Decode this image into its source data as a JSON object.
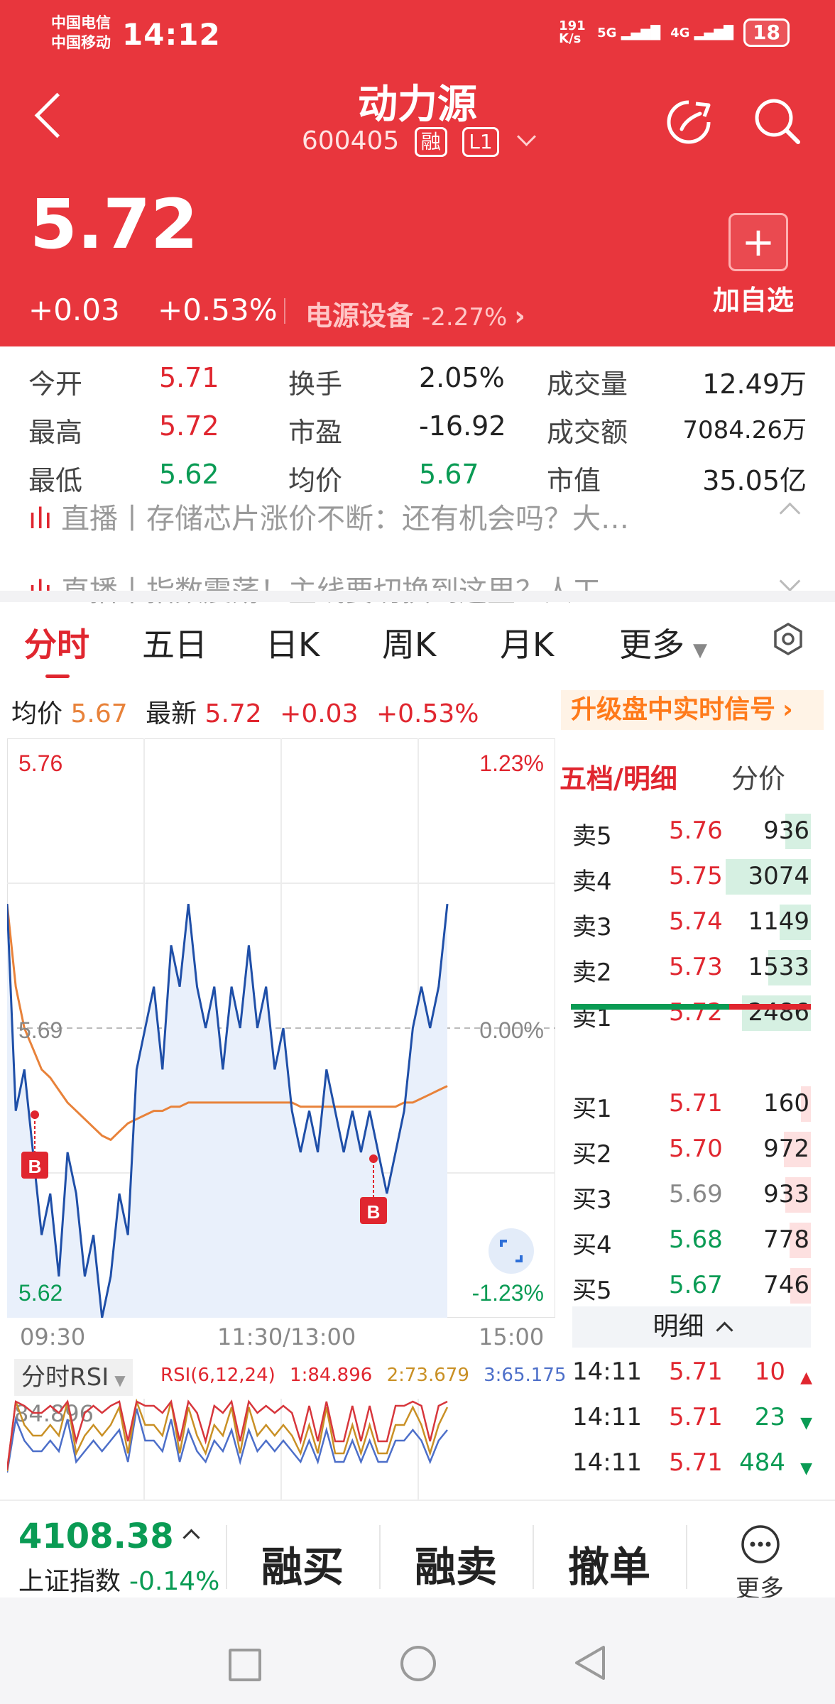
{
  "status_bar": {
    "carrier1": "中国电信",
    "carrier2": "中国移动",
    "time": "14:12",
    "net_speed": "191 K/s",
    "sig1": "5G",
    "sig2": "4G",
    "battery": "18"
  },
  "header": {
    "title": "动力源",
    "code": "600405",
    "tag_rong": "融",
    "tag_level": "L1",
    "price": "5.72",
    "change": "+0.03",
    "change_pct": "+0.53%",
    "sector": "电源设备",
    "sector_pct": "-2.27%",
    "add_label": "加自选"
  },
  "stats": [
    {
      "label": "今开",
      "value": "5.71",
      "color": "red"
    },
    {
      "label": "换手",
      "value": "2.05%",
      "color": "dark"
    },
    {
      "label": "成交量",
      "value": "12.49万",
      "color": "dark"
    },
    {
      "label": "最高",
      "value": "5.72",
      "color": "red"
    },
    {
      "label": "市盈",
      "value": "-16.92",
      "color": "dark"
    },
    {
      "label": "成交额",
      "value": "7084.26万",
      "color": "dark"
    },
    {
      "label": "最低",
      "value": "5.62",
      "color": "green"
    },
    {
      "label": "均价",
      "value": "5.67",
      "color": "green"
    },
    {
      "label": "市值",
      "value": "35.05亿",
      "color": "dark"
    }
  ],
  "news": [
    "直播丨存储芯片涨价不断：还有机会吗？大…",
    "直播丨指数震荡！主线要切换到这里？人工…"
  ],
  "tabs": [
    "分时",
    "五日",
    "日K",
    "周K",
    "月K",
    "更多"
  ],
  "infoline": {
    "avg_label": "均价",
    "avg": "5.67",
    "last_label": "最新",
    "last": "5.72",
    "chg": "+0.03",
    "pct": "+0.53%",
    "upgrade": "升级盘中实时信号"
  },
  "chart": {
    "y_top": "5.76",
    "y_mid": "5.69",
    "y_bottom": "5.62",
    "pct_top": "1.23%",
    "pct_mid": "0.00%",
    "pct_bottom": "-1.23%",
    "x_start": "09:30",
    "x_mid": "11:30/13:00",
    "x_end": "15:00",
    "marker": "B"
  },
  "chart_data": {
    "type": "line",
    "title": "",
    "ylim": [
      5.62,
      5.76
    ],
    "xlabels": [
      "09:30",
      "11:30/13:00",
      "15:00"
    ],
    "series": [
      {
        "values": [
          5.72,
          5.67,
          5.68,
          5.66,
          5.64,
          5.65,
          5.63,
          5.66,
          5.65,
          5.63,
          5.64,
          5.62,
          5.63,
          5.65,
          5.64,
          5.68,
          5.69,
          5.7,
          5.68,
          5.71,
          5.7,
          5.72,
          5.7,
          5.69,
          5.7,
          5.68,
          5.7,
          5.69,
          5.71,
          5.69,
          5.7,
          5.68,
          5.69,
          5.67,
          5.66,
          5.67,
          5.66,
          5.68,
          5.67,
          5.66,
          5.67,
          5.66,
          5.67,
          5.66,
          5.65,
          5.66,
          5.67,
          5.69,
          5.7,
          5.69,
          5.7,
          5.72
        ]
      },
      {
        "values": [
          5.72,
          5.7,
          5.69,
          5.685,
          5.68,
          5.678,
          5.675,
          5.672,
          5.67,
          5.668,
          5.666,
          5.664,
          5.663,
          5.665,
          5.667,
          5.668,
          5.669,
          5.67,
          5.67,
          5.671,
          5.671,
          5.672,
          5.672,
          5.672,
          5.672,
          5.672,
          5.672,
          5.672,
          5.672,
          5.672,
          5.672,
          5.672,
          5.672,
          5.672,
          5.671,
          5.671,
          5.671,
          5.671,
          5.671,
          5.671,
          5.671,
          5.671,
          5.671,
          5.671,
          5.671,
          5.671,
          5.672,
          5.672,
          5.673,
          5.674,
          5.675,
          5.676
        ]
      }
    ]
  },
  "orderbook": {
    "tab1": "五档/明细",
    "tab2": "分价",
    "sells": [
      {
        "label": "卖5",
        "price": "5.76",
        "vol": "936",
        "bar": 0.3,
        "pc": "red"
      },
      {
        "label": "卖4",
        "price": "5.75",
        "vol": "3074",
        "bar": 1.0,
        "pc": "red"
      },
      {
        "label": "卖3",
        "price": "5.74",
        "vol": "1149",
        "bar": 0.37,
        "pc": "red"
      },
      {
        "label": "卖2",
        "price": "5.73",
        "vol": "1533",
        "bar": 0.5,
        "pc": "red"
      },
      {
        "label": "卖1",
        "price": "5.72",
        "vol": "2486",
        "bar": 0.81,
        "pc": "red"
      }
    ],
    "buys": [
      {
        "label": "买1",
        "price": "5.71",
        "vol": "160",
        "bar": 0.12,
        "pc": "red"
      },
      {
        "label": "买2",
        "price": "5.70",
        "vol": "972",
        "bar": 0.32,
        "pc": "red"
      },
      {
        "label": "买3",
        "price": "5.69",
        "vol": "933",
        "bar": 0.3,
        "pc": "gray"
      },
      {
        "label": "买4",
        "price": "5.68",
        "vol": "778",
        "bar": 0.25,
        "pc": "green"
      },
      {
        "label": "买5",
        "price": "5.67",
        "vol": "746",
        "bar": 0.24,
        "pc": "green"
      }
    ],
    "detail_label": "明细",
    "ticks": [
      {
        "time": "14:11",
        "price": "5.71",
        "vol": "10",
        "dir": "up"
      },
      {
        "time": "14:11",
        "price": "5.71",
        "vol": "23",
        "dir": "down"
      },
      {
        "time": "14:11",
        "price": "5.71",
        "vol": "484",
        "dir": "down"
      }
    ]
  },
  "rsi": {
    "label": "分时RSI",
    "params": "RSI(6,12,24)",
    "r1": "1:84.896",
    "r2": "2:73.679",
    "r3": "3:65.175",
    "value": "84.896"
  },
  "bottom": {
    "index_value": "4108.38",
    "index_name": "上证指数",
    "index_pct": "-0.14%",
    "buy": "融买",
    "sell": "融卖",
    "cancel": "撤单",
    "more": "更多"
  },
  "colors": {
    "header_red": "#e8363d",
    "up": "#e0262f",
    "down": "#0a9b54",
    "price_line": "#1f4fa8",
    "avg_line": "#e8823a"
  }
}
